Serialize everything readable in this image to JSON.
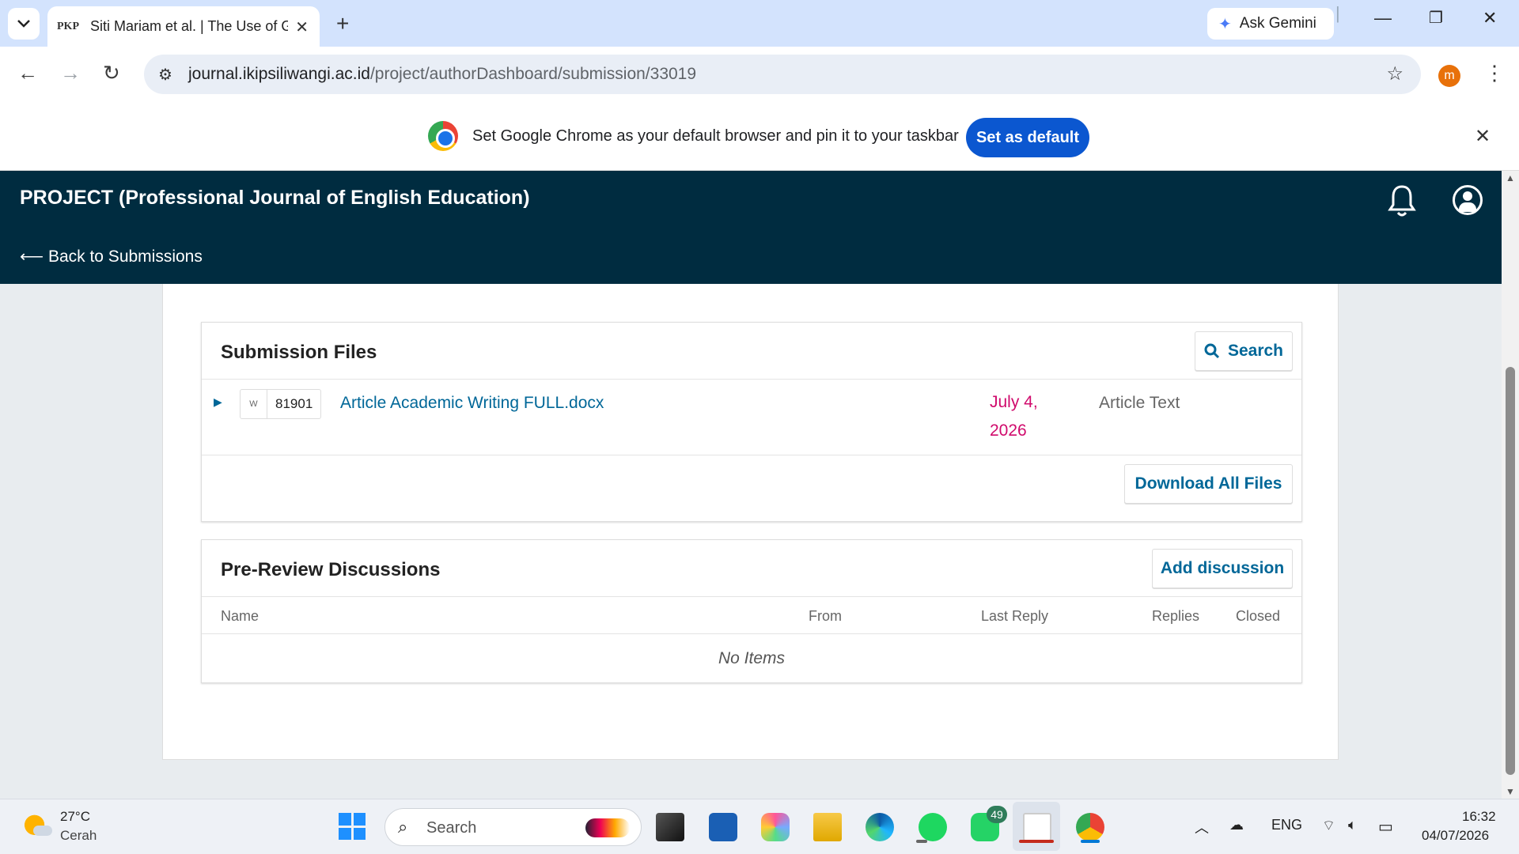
{
  "browser": {
    "tab_icon_text": "PKP",
    "tab_title": "Siti Mariam et al. | The Use of G",
    "new_tab": "+",
    "gemini_label": "Ask Gemini",
    "url_domain": "journal.ikipsiliwangi.ac.id",
    "url_path": "/project/authorDashboard/submission/33019",
    "profile_initial": "m",
    "infobar_message": "Set Google Chrome as your default browser and pin it to your taskbar",
    "set_default_label": "Set as default"
  },
  "ojs": {
    "journal_title": "PROJECT (Professional Journal of English Education)",
    "back_link": "⟵ Back to Submissions"
  },
  "submission_files": {
    "title": "Submission Files",
    "search_label": "Search",
    "files": [
      {
        "id": "81901",
        "name": "Article Academic Writing FULL.docx",
        "date": "July 4, 2026",
        "type": "Article Text"
      }
    ],
    "download_all_label": "Download All Files"
  },
  "discussions": {
    "title": "Pre-Review Discussions",
    "add_label": "Add discussion",
    "columns": [
      "Name",
      "From",
      "Last Reply",
      "Replies",
      "Closed"
    ],
    "empty_text": "No Items"
  },
  "taskbar": {
    "weather_temp": "27°C",
    "weather_desc": "Cerah",
    "search_placeholder": "Search",
    "whatsapp_badge": "49",
    "language": "ENG",
    "time": "16:32",
    "date": "04/07/2026"
  },
  "colors": {
    "header_bg": "#002c40",
    "link": "#006798",
    "date": "#d00a6c",
    "chrome_blue": "#0b57d0"
  }
}
